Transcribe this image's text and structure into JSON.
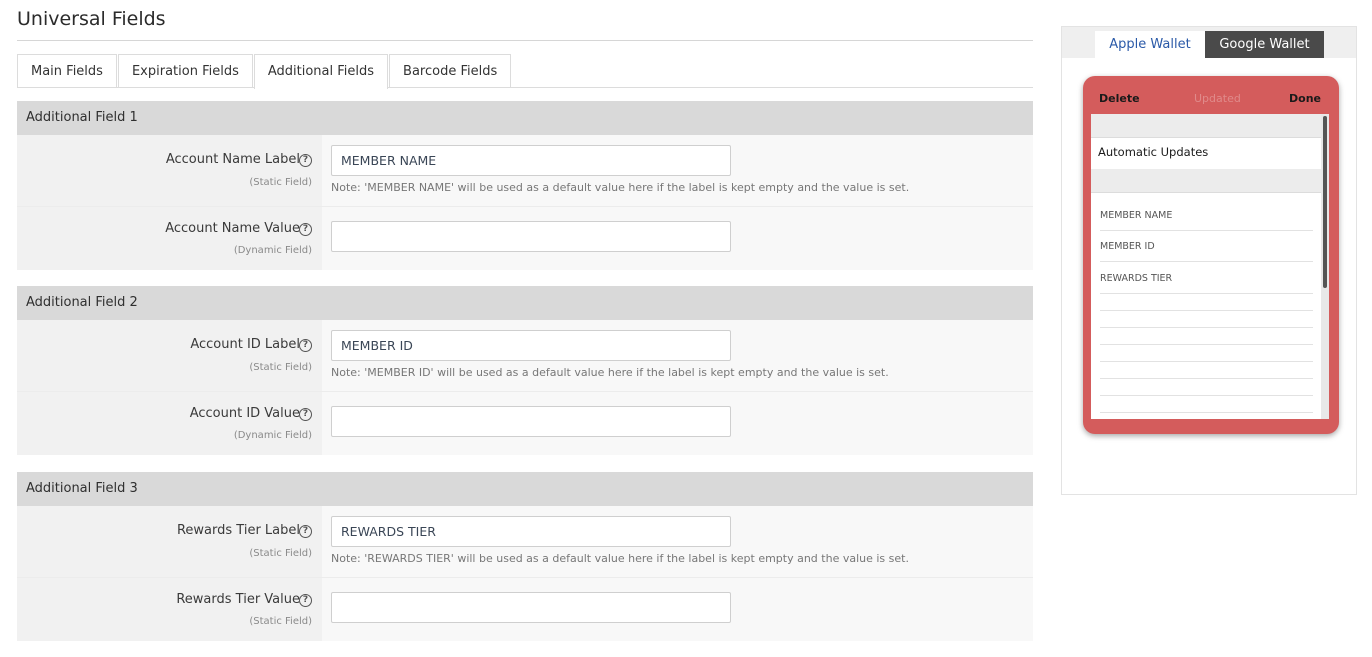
{
  "page": {
    "title": "Universal Fields"
  },
  "tabs": [
    {
      "label": "Main Fields",
      "active": false
    },
    {
      "label": "Expiration Fields",
      "active": false
    },
    {
      "label": "Additional Fields",
      "active": true
    },
    {
      "label": "Barcode Fields",
      "active": false
    }
  ],
  "sections": [
    {
      "title": "Additional Field 1",
      "label_row": {
        "label": "Account Name Label",
        "sub": "(Static Field)",
        "value": "MEMBER NAME",
        "note": "Note: 'MEMBER NAME' will be used as a default value here if the label is kept empty and the value is set."
      },
      "value_row": {
        "label": "Account Name Value",
        "sub": "(Dynamic Field)",
        "value": ""
      }
    },
    {
      "title": "Additional Field 2",
      "label_row": {
        "label": "Account ID Label",
        "sub": "(Static Field)",
        "value": "MEMBER ID",
        "note": "Note: 'MEMBER ID' will be used as a default value here if the label is kept empty and the value is set."
      },
      "value_row": {
        "label": "Account ID Value",
        "sub": "(Dynamic Field)",
        "value": ""
      }
    },
    {
      "title": "Additional Field 3",
      "label_row": {
        "label": "Rewards Tier Label",
        "sub": "(Static Field)",
        "value": "REWARDS TIER",
        "note": "Note: 'REWARDS TIER' will be used as a default value here if the label is kept empty and the value is set."
      },
      "value_row": {
        "label": "Rewards Tier Value",
        "sub": "(Static Field)",
        "value": ""
      }
    }
  ],
  "help_glyph": "?",
  "preview": {
    "tabs": {
      "apple": "Apple Wallet",
      "google": "Google Wallet"
    },
    "delete": "Delete",
    "updated": "Updated",
    "done": "Done",
    "automatic_updates": "Automatic Updates",
    "items": [
      "MEMBER NAME",
      "MEMBER ID",
      "REWARDS TIER"
    ],
    "phone_color": "#d45c5c"
  }
}
